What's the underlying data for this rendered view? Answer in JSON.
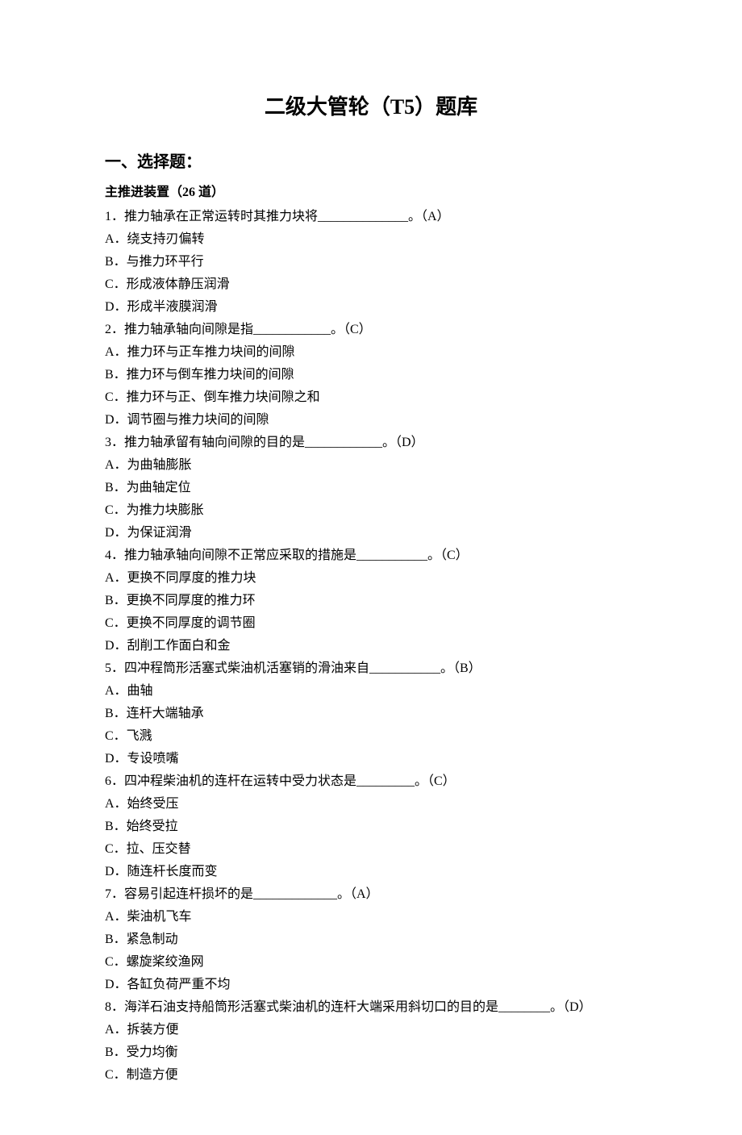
{
  "title": "二级大管轮（T5）题库",
  "section_heading": "一、选择题：",
  "sub_heading": "主推进装置（26 道）",
  "questions": [
    {
      "stem": "1．推力轴承在正常运转时其推力块将______________。（A）",
      "options": [
        "A．绕支持刃偏转",
        "B．与推力环平行",
        "C．形成液体静压润滑",
        "D．形成半液膜润滑"
      ]
    },
    {
      "stem": "2．推力轴承轴向间隙是指____________。（C）",
      "options": [
        "A．推力环与正车推力块间的间隙",
        "B．推力环与倒车推力块间的间隙",
        "C．推力环与正、倒车推力块间隙之和",
        "D．调节圈与推力块间的间隙"
      ]
    },
    {
      "stem": "3．推力轴承留有轴向间隙的目的是____________。（D）",
      "options": [
        "A．为曲轴膨胀",
        "B．为曲轴定位",
        "C．为推力块膨胀",
        "D．为保证润滑"
      ]
    },
    {
      "stem": "4．推力轴承轴向间隙不正常应采取的措施是___________。（C）",
      "options": [
        "A．更换不同厚度的推力块",
        "B．更换不同厚度的推力环",
        "C．更换不同厚度的调节圈",
        "D．刮削工作面白和金"
      ]
    },
    {
      "stem": "5．四冲程筒形活塞式柴油机活塞销的滑油来自___________。（B）",
      "options": [
        "A．曲轴",
        "B．连杆大端轴承",
        "C．飞溅",
        "D．专设喷嘴"
      ]
    },
    {
      "stem": "6．四冲程柴油机的连杆在运转中受力状态是_________。（C）",
      "options": [
        "A．始终受压",
        "B．始终受拉",
        "C．拉、压交替",
        "D．随连杆长度而变"
      ]
    },
    {
      "stem": "7．容易引起连杆损坏的是_____________。（A）",
      "options": [
        "A．柴油机飞车",
        "B．紧急制动",
        "C．螺旋桨绞渔网",
        "D．各缸负荷严重不均"
      ]
    },
    {
      "stem": "8．海洋石油支持船筒形活塞式柴油机的连杆大端采用斜切口的目的是________。（D）",
      "options": [
        "A．拆装方便",
        "B．受力均衡",
        "C．制造方便"
      ]
    }
  ]
}
